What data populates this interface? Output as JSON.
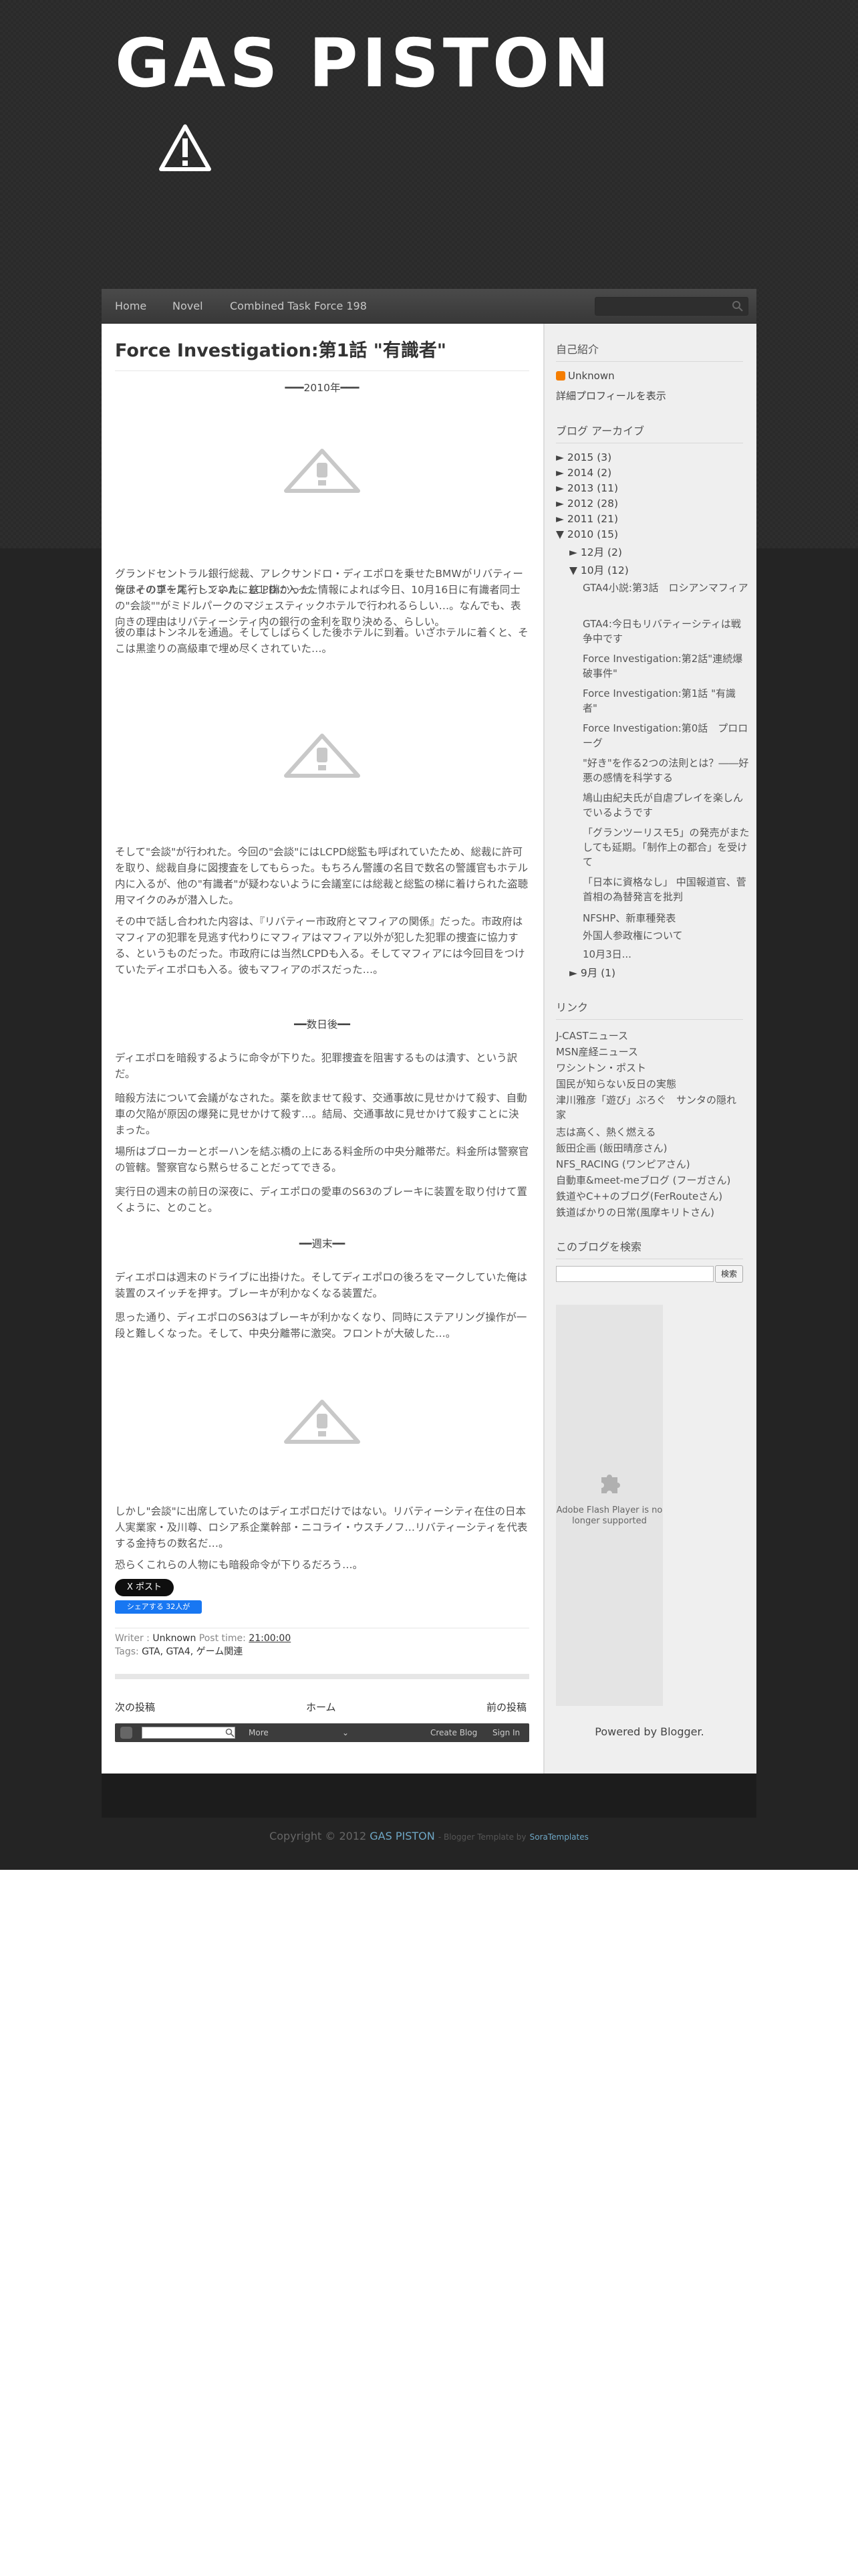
{
  "header": {
    "site_title": "GAS PISTON"
  },
  "nav": {
    "items": [
      "Home",
      "Novel",
      "Combined Task Force 198"
    ]
  },
  "post": {
    "title": "Force Investigation:第1話 \"有識者\"",
    "year_heading": "━━━2010年━━━",
    "p1": "グランドセントラル銀行総裁、アレクサンドロ・ディエポロを乗せたBMWがリバティーシティのブース・トンネルに差し掛かった。",
    "p2": "俺はその車を尾行していた。LCPDに入った情報によれば今日、10月16日に有識者同士の\"会談\"\"がミドルパークのマジェスティックホテルで行われるらしい…。なんでも、表向きの理由はリバティーシティ内の銀行の金利を取り決める、らしい。",
    "p3": "彼の車はトンネルを通過。そしてしばらくした後ホテルに到着。いざホテルに着くと、そこは黒塗りの高級車で埋め尽くされていた…。",
    "p4": "そして\"会談\"が行われた。今回の\"会談\"にはLCPD総監も呼ばれていたため、総裁に許可を取り、総裁自身に図捜査をしてもらった。もちろん警護の名目で数名の警護官もホテル内に入るが、他の\"有識者\"が疑わないように会議室には総裁と総監の梯に着けられた盗聴用マイクのみが潜入した。",
    "p5": "その中で話し合われた内容は、『リバティー市政府とマフィアの関係』だった。市政府はマフィアの犯罪を見逃す代わりにマフィアはマフィア以外が犯した犯罪の捜査に協力する、というものだった。市政府には当然LCPDも入る。そしてマフィアには今回目をつけていたディエポロも入る。彼もマフィアのボスだった…。",
    "h2": "━━数日後━━",
    "p6": "ディエポロを暗殺するように命令が下りた。犯罪捜査を阻害するものは潰す、という訳だ。",
    "p7": "暗殺方法について会議がなされた。薬を飲ませて殺す、交通事故に見せかけて殺す、自動車の欠陥が原因の爆発に見せかけて殺す…。結局、交通事故に見せかけて殺すことに決まった。",
    "p8": "場所はブローカーとボーハンを結ぶ橋の上にある料金所の中央分離帯だ。料金所は警察官の管轄。警察官なら黙らせることだってできる。",
    "p9": "実行日の週末の前日の深夜に、ディエポロの愛車のS63のブレーキに装置を取り付けて置くように、とのこと。",
    "h3": "━━週末━━",
    "p10": "ディエポロは週末のドライブに出掛けた。そしてディエポロの後ろをマークしていた俺は装置のスイッチを押す。ブレーキが利かなくなる装置だ。",
    "p11": "思った通り、ディエポロのS63はブレーキが利かなくなり、同時にステアリング操作が一段と難しくなった。そして、中央分離帯に激突。フロントが大破した…。",
    "p12": "しかし\"会談\"に出席していたのはディエポロだけではない。リバティーシティ在住の日本人実業家・及川尊、ロシア系企業幹部・ニコライ・ウスチノフ…リバティーシティを代表する金持ちの数名だ…。",
    "p13": "恐らくこれらの人物にも暗殺命令が下りるだろう…。",
    "x_post": "X ポスト",
    "fb_share": "シェアする 32人が",
    "writer_label": "Writer :",
    "writer": "Unknown",
    "posttime_label": "Post time:",
    "posttime": "21:00:00",
    "tags_label": "Tags:",
    "tags": "GTA, GTA4, ゲーム関連",
    "pager_newer": "次の投稿",
    "pager_home": "ホーム",
    "pager_older": "前の投稿"
  },
  "navbar_blogger": {
    "more": "More",
    "create_blog": "Create Blog",
    "sign_in": "Sign In"
  },
  "sidebar": {
    "profile_heading": "自己紹介",
    "profile_name": "Unknown",
    "profile_link": "詳細プロフィールを表示",
    "archive_heading": "ブログ アーカイブ",
    "years": [
      {
        "label": "► 2015 (3)"
      },
      {
        "label": "► 2014 (2)"
      },
      {
        "label": "► 2013 (11)"
      },
      {
        "label": "► 2012 (28)"
      },
      {
        "label": "► 2011 (21)"
      },
      {
        "label": "▼ 2010 (15)"
      }
    ],
    "dec": "► 12月 (2)",
    "oct": "▼ 10月 (12)",
    "oct_posts": [
      "GTA4小説:第3話　ロシアンマフィア",
      "GTA4:今日もリバティーシティは戦争中です",
      "Force Investigation:第2話\"連続爆破事件\"",
      "Force Investigation:第1話 \"有識者\"",
      "Force Investigation:第0話　プロローグ",
      "\"好き\"を作る2つの法則とは？――好悪の感情を科学する",
      "鳩山由紀夫氏が自虐プレイを楽しんでいるようです",
      "「グランツーリスモ5」の発売がまたしても延期。「制作上の都合」を受けて",
      "「日本に資格なし」 中国報道官、菅首相の為替発言を批判",
      "NFSHP、新車種発表",
      "外国人参政権について",
      "10月3日..."
    ],
    "sep": "► 9月 (1)",
    "links_heading": "リンク",
    "links": [
      "J-CASTニュース",
      "MSN産経ニュース",
      "ワシントン・ポスト",
      "国民が知らない反日の実態",
      "津川雅彦「遊び」ぶろぐ　サンタの隠れ家",
      "志は高く、熱く燃える",
      "飯田企画 (飯田晴彦さん)",
      "NFS_RACING (ワンピアさん)",
      "自動車&meet-meブログ (フーガさん)",
      "鉄道やC++のブログ(FerRouteさん)",
      "鉄道ばかりの日常(風摩キリトさん)"
    ],
    "search_heading": "このブログを検索",
    "search_button": "検索",
    "flash_text": "Adobe Flash Player is no longer supported",
    "powered": "Powered by Blogger."
  },
  "footer": {
    "copyright": "Copyright © 2012",
    "site": "GAS PISTON",
    "template_by": "- Blogger Template by",
    "sora": "SoraTemplates"
  }
}
